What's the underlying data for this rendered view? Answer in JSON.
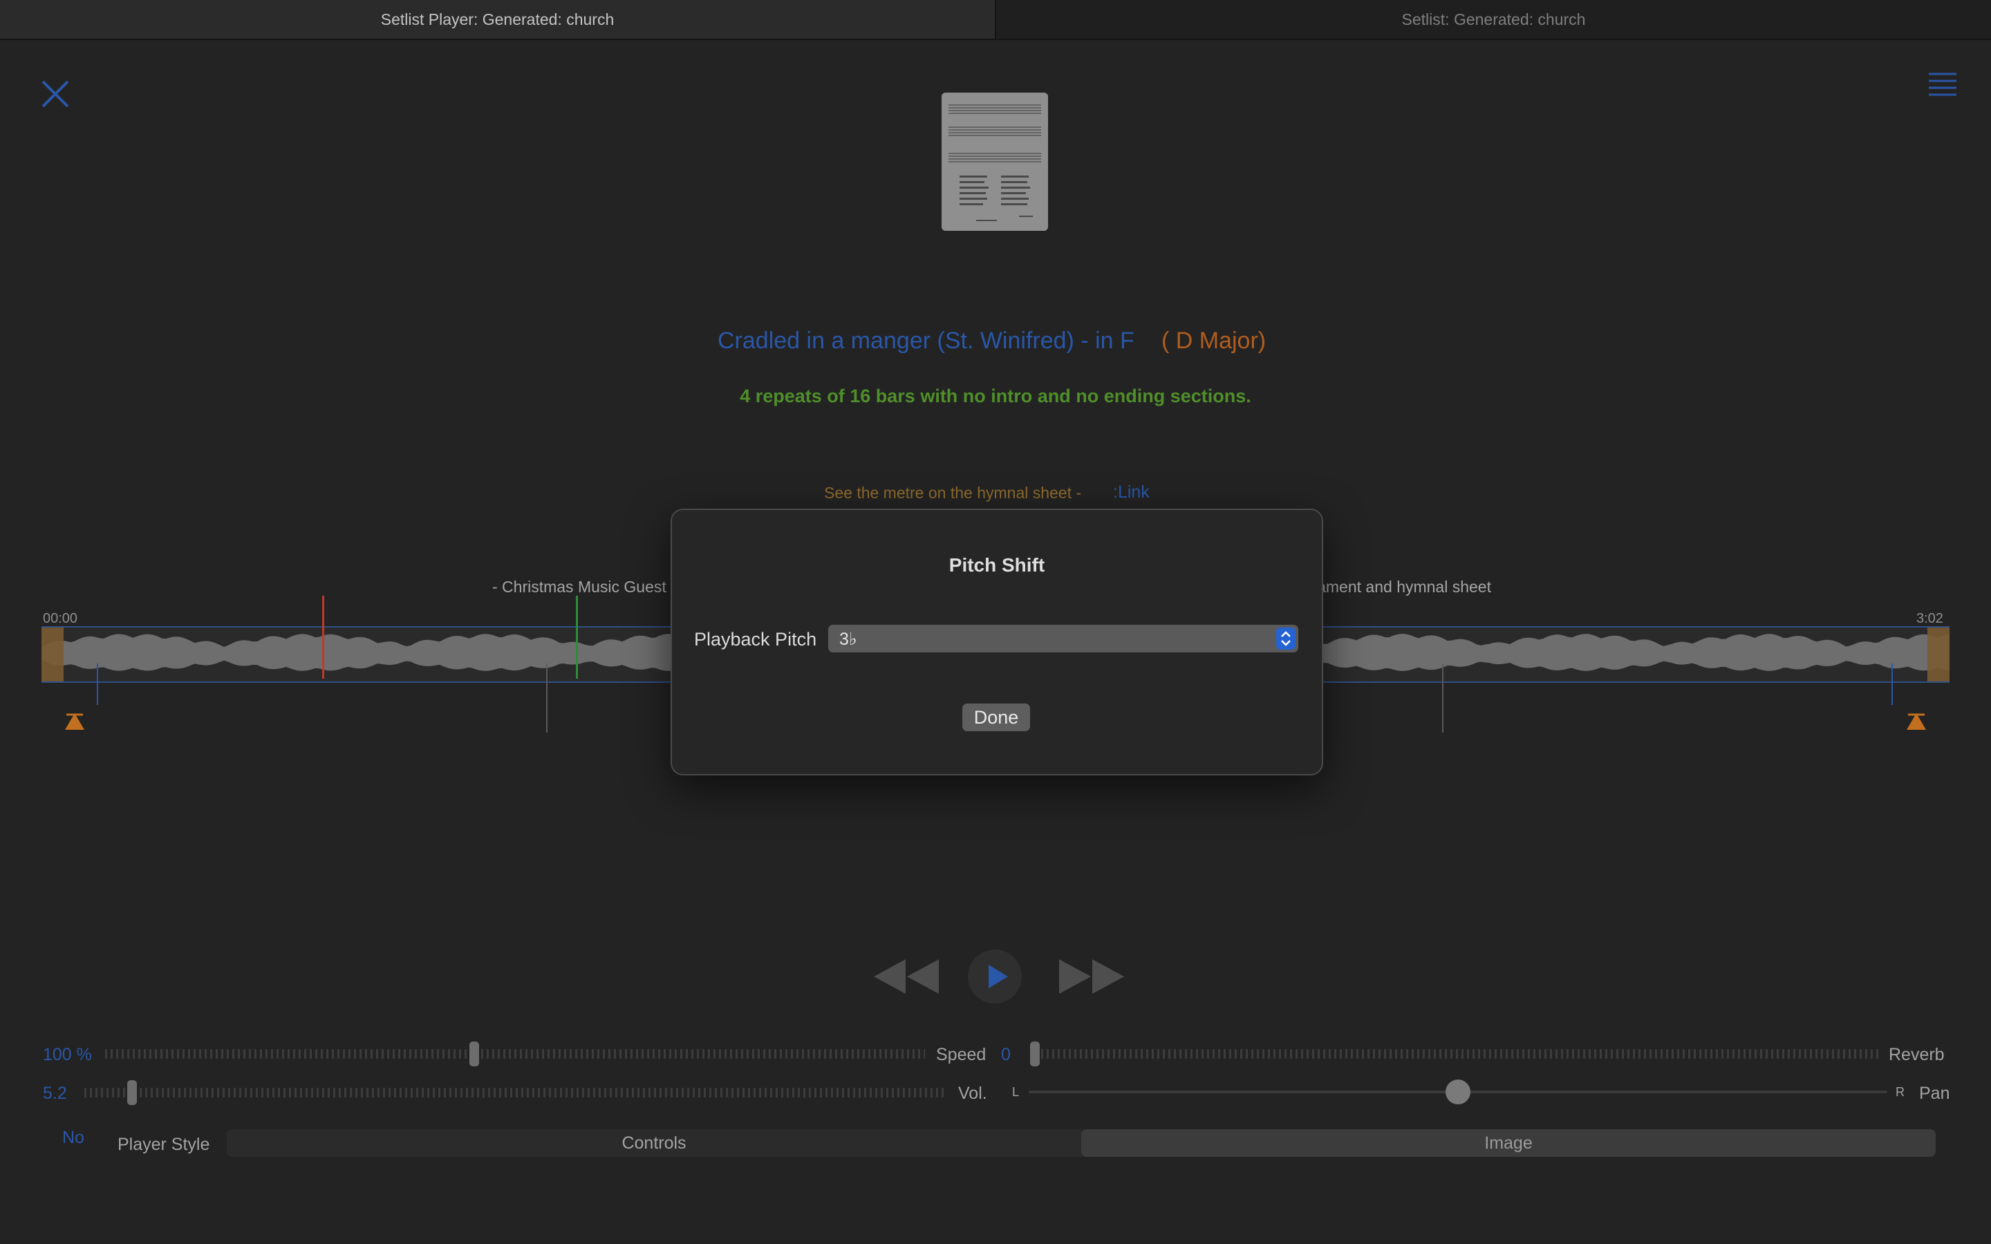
{
  "tabs": [
    {
      "label": "Setlist Player: Generated: church"
    },
    {
      "label": "Setlist: Generated: church"
    }
  ],
  "icons": {
    "close": "close-x-icon",
    "menu": "hamburger-menu-icon",
    "play": "play-icon",
    "rewind": "rewind-icon",
    "fast_forward": "fast-forward-icon"
  },
  "song": {
    "title": "Cradled in a manger (St. Winifred) - in F",
    "key": "( D Major)",
    "repeats": "4 repeats of 16 bars with no intro and no ending sections.",
    "metre_note": "See the metre on the hymnal sheet -",
    "link": ":Link"
  },
  "waveform": {
    "start_time": "00:00",
    "end_time": "3:02",
    "caption_left": "- Christmas Music Guest",
    "caption_right": "iament and hymnal sheet"
  },
  "dialog": {
    "title": "Pitch Shift",
    "pitch_label": "Playback Pitch",
    "pitch_value": "3♭",
    "done_label": "Done"
  },
  "controls": {
    "speed_value": "100 %",
    "speed_label": "Speed",
    "speed_level": 0.45,
    "reverb_value": "0",
    "reverb_label": "Reverb",
    "reverb_level": 0.0,
    "volume_value": "5.2",
    "volume_label": "Vol.",
    "volume_level": 0.05,
    "pan_left": "L",
    "pan_right": "R",
    "pan_label": "Pan",
    "pan_level": 0.5,
    "no_label": "No",
    "player_style_label": "Player Style",
    "segments": [
      "Controls",
      "Image"
    ],
    "selected_segment": "Image"
  },
  "colors": {
    "accent_blue": "#2a57a8",
    "key_orange": "#b05d1e",
    "repeats_green": "#4f8f2a",
    "marker_red": "#c0392b",
    "marker_green": "#2e8b3a"
  }
}
